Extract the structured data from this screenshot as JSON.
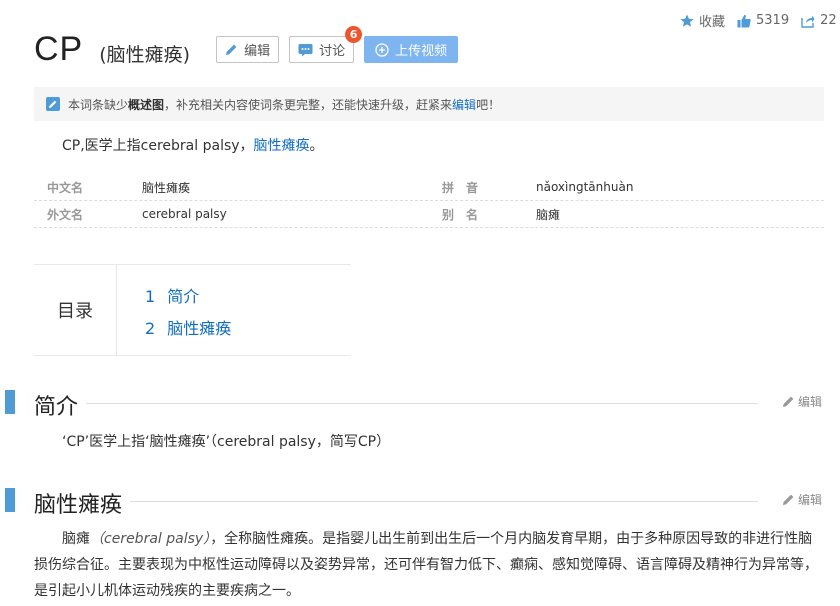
{
  "top_actions": {
    "collect_label": "收藏",
    "like_count": "5319",
    "share_count": "22"
  },
  "title": {
    "main": "CP",
    "sub": "(脑性瘫痪)"
  },
  "buttons": {
    "edit": "编辑",
    "discuss": "讨论",
    "discuss_badge": "6",
    "upload": "上传视频"
  },
  "notice": {
    "prefix": "本词条缺少",
    "bold": "概述图",
    "middle": "，补充相关内容使词条更完整，还能快速升级，赶紧来",
    "link": "编辑",
    "suffix": "吧！"
  },
  "summary": {
    "text": "CP,医学上指cerebral palsy，",
    "link": "脑性瘫痪",
    "end": "。"
  },
  "basic_info": [
    {
      "k1": "中文名",
      "v1": "脑性瘫痪",
      "k2": "拼　音",
      "v2": "nǎoxìngtānhuàn"
    },
    {
      "k1": "外文名",
      "v1": "cerebral palsy",
      "k2": "别　名",
      "v2": "脑瘫"
    }
  ],
  "toc": {
    "heading": "目录",
    "items": [
      {
        "num": "1",
        "label": "简介"
      },
      {
        "num": "2",
        "label": "脑性瘫痪"
      }
    ]
  },
  "sections": [
    {
      "title": "简介",
      "edit": "编辑",
      "para": "‘CP’医学上指‘脑性瘫痪’（cerebral palsy，简写CP）"
    },
    {
      "title": "脑性瘫痪",
      "edit": "编辑",
      "para_lead": "脑瘫",
      "para_italic": "（cerebral palsy）",
      "para_rest": "，全称脑性瘫痪。是指婴儿出生前到出生后一个月内脑发育早期，由于多种原因导致的非进行性脑损伤综合征。主要表现为中枢性运动障碍以及姿势异常，还可伴有智力低下、癫痫、感知觉障碍、语言障碍及精神行为异常等，是引起小儿机体运动残疾的主要疾病之一。"
    }
  ],
  "colors": {
    "link": "#136ec2",
    "accent": "#4f9bd8",
    "badge": "#f0542d",
    "upload_button": "#7eb5f1"
  }
}
